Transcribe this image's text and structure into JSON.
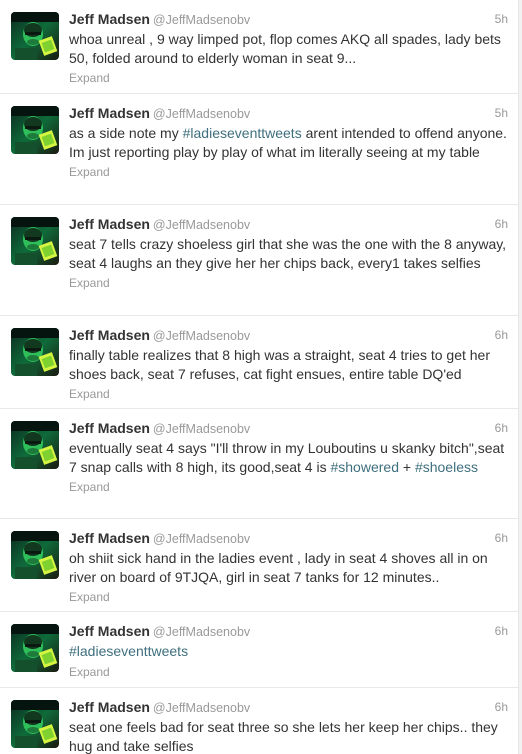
{
  "tweets": [
    {
      "name": "Jeff Madsen",
      "handle": "@JeffMadsenobv",
      "time": "5h",
      "text_before": "whoa unreal , 9 way limped pot, flop comes AKQ all spades, lady bets 50, folded around to elderly woman in seat 9...",
      "hashtag": "",
      "text_after": "",
      "expand": "Expand"
    },
    {
      "name": "Jeff Madsen",
      "handle": "@JeffMadsenobv",
      "time": "5h",
      "text_before": "as a side note my ",
      "hashtag": "#ladieseventtweets",
      "text_after": " arent intended to offend anyone. Im just reporting play by play of what im literally seeing at my table",
      "expand": "Expand"
    },
    {
      "name": "Jeff Madsen",
      "handle": "@JeffMadsenobv",
      "time": "6h",
      "text_before": "seat 7 tells crazy shoeless girl that she was the one with the 8 anyway, seat 4 laughs an they give her her chips back, every1 takes selfies",
      "hashtag": "",
      "text_after": "",
      "expand": "Expand"
    },
    {
      "name": "Jeff Madsen",
      "handle": "@JeffMadsenobv",
      "time": "6h",
      "text_before": "finally table realizes that 8 high was a straight, seat 4 tries to get her shoes back, seat 7 refuses, cat fight ensues, entire table DQ'ed",
      "hashtag": "",
      "text_after": "",
      "expand": "Expand"
    },
    {
      "name": "Jeff Madsen",
      "handle": "@JeffMadsenobv",
      "time": "6h",
      "text_before": "eventually seat 4 says \"I'll throw in my Louboutins u skanky bitch\",seat 7 snap calls with 8 high, its good,seat 4 is ",
      "hashtag": "#showered",
      "text_mid": " + ",
      "hashtag2": "#shoeless",
      "text_after": "",
      "expand": "Expand"
    },
    {
      "name": "Jeff Madsen",
      "handle": "@JeffMadsenobv",
      "time": "6h",
      "text_before": "oh shiit sick hand in the ladies event , lady in seat 4 shoves all in on river on board of 9TJQA, girl in seat 7 tanks for 12 minutes..",
      "hashtag": "",
      "text_after": "",
      "expand": "Expand"
    },
    {
      "name": "Jeff Madsen",
      "handle": "@JeffMadsenobv",
      "time": "6h",
      "text_before": "",
      "hashtag": "#ladieseventtweets",
      "text_after": "",
      "expand": "Expand"
    },
    {
      "name": "Jeff Madsen",
      "handle": "@JeffMadsenobv",
      "time": "6h",
      "text_before": "seat one feels bad for seat three so she lets her keep her chips.. they hug and take selfies",
      "hashtag": "",
      "text_after": "",
      "expand": ""
    }
  ],
  "colors": {
    "hashtag": "#3e6f7e",
    "meta": "#999999",
    "text": "#333333",
    "divider": "#e8e8e8"
  },
  "icons": {
    "avatar": "profile-photo-avatar"
  }
}
